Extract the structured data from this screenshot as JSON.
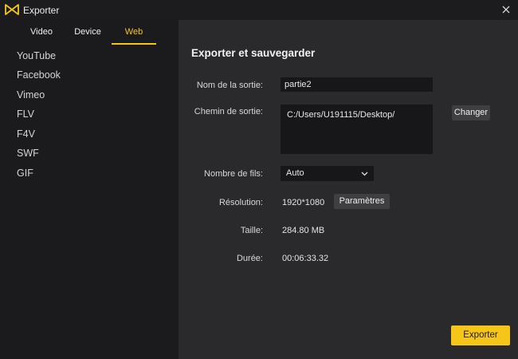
{
  "window": {
    "title": "Exporter",
    "close_icon": "close-icon",
    "logo_icon": "bowtie-logo-icon"
  },
  "tabs": [
    {
      "label": "Video",
      "active": false
    },
    {
      "label": "Device",
      "active": false
    },
    {
      "label": "Web",
      "active": true
    }
  ],
  "sidebar": {
    "items": [
      {
        "label": "YouTube"
      },
      {
        "label": "Facebook"
      },
      {
        "label": "Vimeo"
      },
      {
        "label": "FLV"
      },
      {
        "label": "F4V"
      },
      {
        "label": "SWF"
      },
      {
        "label": "GIF"
      }
    ]
  },
  "main": {
    "title": "Exporter et sauvegarder",
    "output_name": {
      "label": "Nom de la sortie:",
      "value": "partie2"
    },
    "output_path": {
      "label": "Chemin de sortie:",
      "value": "C:/Users/U191115/Desktop/",
      "change_label": "Changer"
    },
    "threads": {
      "label": "Nombre de fils:",
      "selected": "Auto",
      "chevron_icon": "chevron-down-icon"
    },
    "resolution": {
      "label": "Résolution:",
      "value": "1920*1080",
      "settings_label": "Paramètres"
    },
    "size": {
      "label": "Taille:",
      "value": "284.80 MB"
    },
    "duration": {
      "label": "Durée:",
      "value": "00:06:33.32"
    },
    "export_label": "Exporter"
  },
  "colors": {
    "accent": "#f5c518",
    "sidebar_bg": "#1b1b1d",
    "panel_bg": "#2a2a2c",
    "field_bg": "#171719"
  }
}
